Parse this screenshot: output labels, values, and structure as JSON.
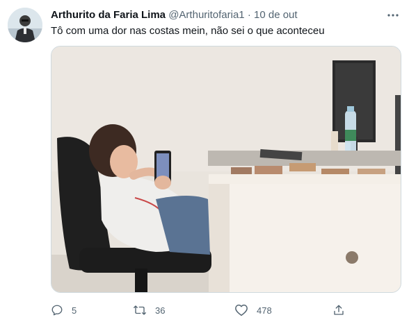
{
  "tweet": {
    "display_name": "Arthurito da Faria Lima",
    "handle": "@Arthuritofaria1",
    "separator": "·",
    "timestamp": "10 de out",
    "text": "Tô com uma dor nas costas mein, não sei o que aconteceu",
    "avatar_icon": "profile-photo",
    "more_icon": "more-horizontal-icon",
    "media_description_icon": "photo"
  },
  "actions": {
    "reply": {
      "icon": "reply-icon",
      "count": "5"
    },
    "retweet": {
      "icon": "retweet-icon",
      "count": "36"
    },
    "like": {
      "icon": "heart-icon",
      "count": "478"
    },
    "share": {
      "icon": "share-icon"
    }
  },
  "colors": {
    "text_primary": "#0f1419",
    "text_secondary": "#536471",
    "border": "#cfd9de"
  }
}
